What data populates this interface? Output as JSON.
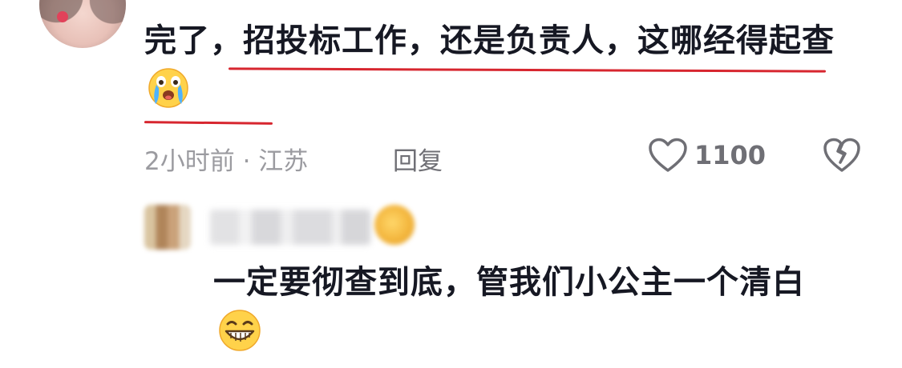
{
  "comment": {
    "text_line": "完了，招投标工作，还是负责人，这哪经得起查",
    "emoji": "crying-emoji",
    "meta": "2小时前 · 江苏",
    "reply_label": "回复",
    "like_count": "1100"
  },
  "reply": {
    "text": "一定要彻查到底，管我们小公主一个清白",
    "emoji": "grinning-emoji"
  },
  "colors": {
    "underline": "#d7262f",
    "text": "#161823",
    "meta": "#9b9ba0"
  }
}
